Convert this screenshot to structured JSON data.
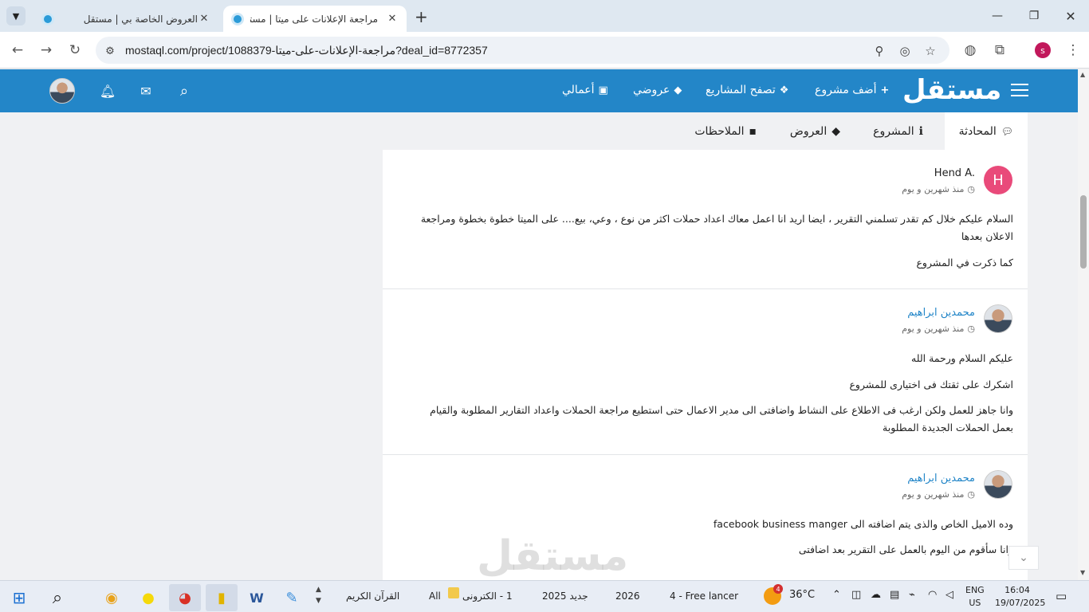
{
  "browser": {
    "tabs": [
      {
        "title": "العروض الخاصة بي | مستقل",
        "active": false
      },
      {
        "title": "مراجعة الإعلانات على ميتا | مستقا",
        "active": true
      }
    ],
    "new_tab": "+",
    "url": "mostaql.com/project/1088379-مراجعة-الإعلانات-على-ميتا?deal_id=8772357",
    "profile_initial": "s"
  },
  "site": {
    "logo": "مستقل",
    "nav": {
      "add_project": "أضف مشروع",
      "browse_projects": "تصفح المشاريع",
      "my_offers": "عروضي",
      "my_works": "أعمالي"
    }
  },
  "tabs": {
    "conversation": "المحادثة",
    "project": "المشروع",
    "offers": "العروض",
    "notes": "الملاحظات"
  },
  "messages": [
    {
      "avatar_letter": "H",
      "name": "Hend A.",
      "time": "منذ شهرين و يوم",
      "paragraphs": [
        "السلام عليكم خلال كم تقدر تسلمني التقرير ، ايضا اريد انا اعمل معاك اعداد حملات اكثر من نوع ، وعي، بيع.... على الميتا خطوة بخطوة ومراجعة الاعلان بعدها",
        "كما ذكرت في المشروع"
      ]
    },
    {
      "name": "محمدين ابراهيم",
      "time": "منذ شهرين و يوم",
      "paragraphs": [
        "عليكم السلام ورحمة الله",
        "اشكرك على ثقتك فى اختيارى للمشروع",
        "وانا جاهز للعمل ولكن ارغب فى الاطلاع على النشاط واضافتى الى مدير الاعمال حتى استطيع مراجعة الحملات واعداد التقارير المطلوبة والقيام بعمل الحملات الجديدة المطلوبة"
      ]
    },
    {
      "name": "محمدين ابراهيم",
      "time": "منذ شهرين و يوم",
      "paragraphs": [
        "وده الاميل الخاص والذى يتم اضافته الى facebook business manger",
        "وانا سأقوم من اليوم بالعمل على التقرير بعد اضافتى"
      ]
    }
  ],
  "watermark": "مستقل",
  "taskbar": {
    "windows": [
      "القرآن الكريم",
      "All",
      "1 - الكترونى",
      "جديد 2025",
      "2026",
      "4 - Free lancer"
    ],
    "weather": "36°C",
    "lang_top": "ENG",
    "lang_bottom": "US",
    "time": "16:04",
    "date": "19/07/2025",
    "weather_badge": "4"
  }
}
